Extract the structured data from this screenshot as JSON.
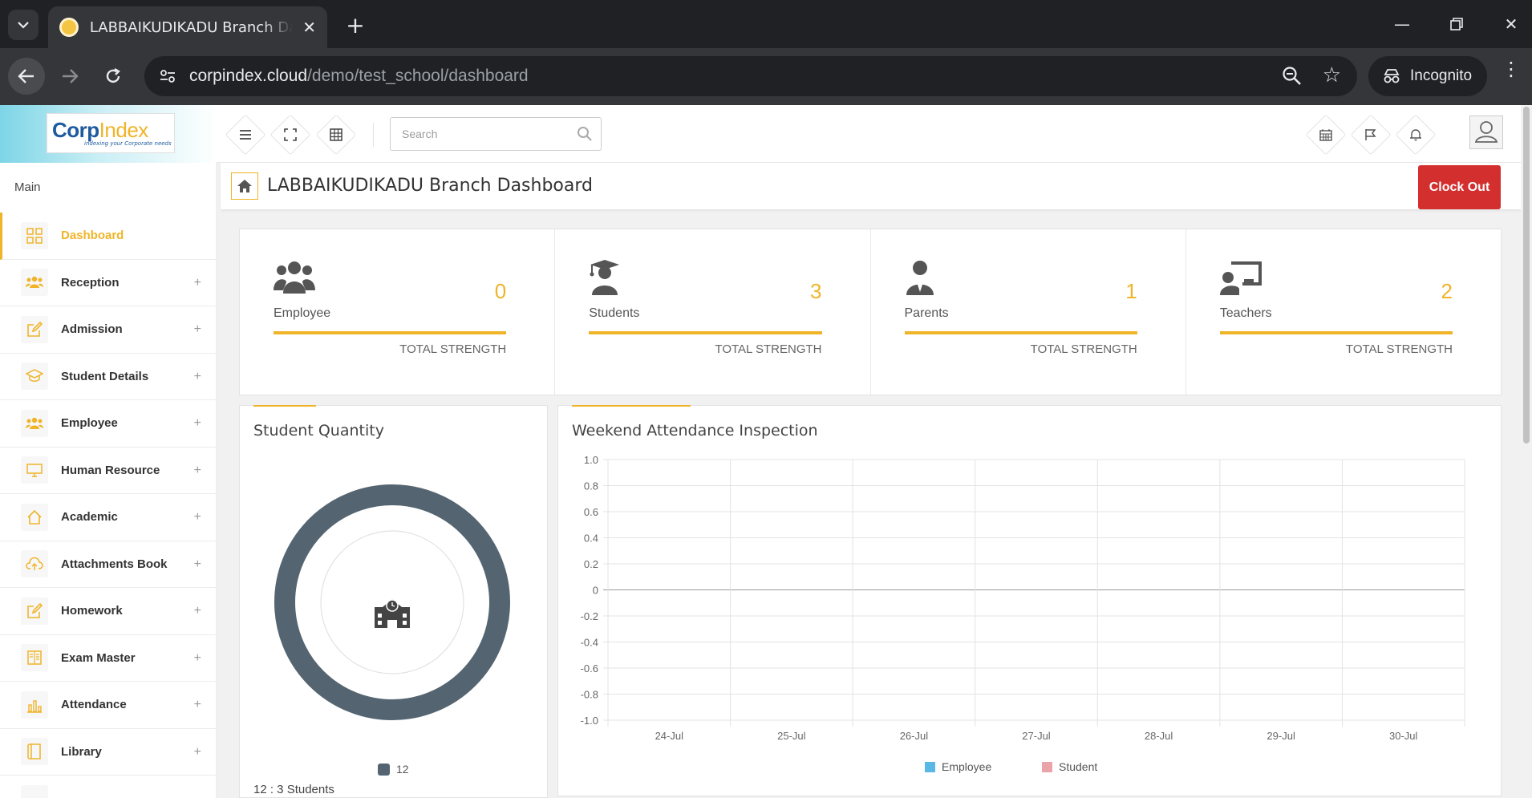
{
  "browser": {
    "tab_title": "LABBAIKUDIKADU Branch Dashboard",
    "url_host": "corpindex.cloud",
    "url_path": "/demo/test_school/dashboard",
    "profile_label": "Incognito"
  },
  "header": {
    "logo_main": "Corp",
    "logo_accent": "Index",
    "logo_tagline": "indexing your Corporate needs",
    "search_placeholder": "Search"
  },
  "sidebar": {
    "section": "Main",
    "items": [
      {
        "label": "Dashboard",
        "icon": "grid-icon",
        "active": true
      },
      {
        "label": "Reception",
        "icon": "users-icon"
      },
      {
        "label": "Admission",
        "icon": "edit-icon"
      },
      {
        "label": "Student Details",
        "icon": "graduation-cap-icon"
      },
      {
        "label": "Employee",
        "icon": "users-icon"
      },
      {
        "label": "Human Resource",
        "icon": "monitor-icon"
      },
      {
        "label": "Academic",
        "icon": "home-icon"
      },
      {
        "label": "Attachments Book",
        "icon": "cloud-upload-icon"
      },
      {
        "label": "Homework",
        "icon": "edit-icon"
      },
      {
        "label": "Exam Master",
        "icon": "book-icon"
      },
      {
        "label": "Attendance",
        "icon": "bar-chart-icon"
      },
      {
        "label": "Library",
        "icon": "book-icon"
      }
    ]
  },
  "page": {
    "title": "LABBAIKUDIKADU Branch Dashboard",
    "clock_out": "Clock Out"
  },
  "stats": [
    {
      "label": "Employee",
      "value": "0",
      "sub": "TOTAL STRENGTH",
      "icon": "employees-icon"
    },
    {
      "label": "Students",
      "value": "3",
      "sub": "TOTAL STRENGTH",
      "icon": "student-icon"
    },
    {
      "label": "Parents",
      "value": "1",
      "sub": "TOTAL STRENGTH",
      "icon": "parent-icon"
    },
    {
      "label": "Teachers",
      "value": "2",
      "sub": "TOTAL STRENGTH",
      "icon": "teacher-icon"
    }
  ],
  "student_quantity": {
    "title": "Student Quantity",
    "legend": "12",
    "footer": "12 : 3 Students"
  },
  "colors": {
    "accent": "#f0b429",
    "danger": "#d32f2f",
    "donut": "#546571",
    "employee_series": "#5bb8e6",
    "student_series": "#e9a3a9"
  },
  "chart_data": {
    "type": "line",
    "title": "Weekend Attendance Inspection",
    "categories": [
      "24-Jul",
      "25-Jul",
      "26-Jul",
      "27-Jul",
      "28-Jul",
      "29-Jul",
      "30-Jul"
    ],
    "ylim": [
      -1.0,
      1.0
    ],
    "yticks": [
      "1.0",
      "0.8",
      "0.6",
      "0.4",
      "0.2",
      "0",
      "-0.2",
      "-0.4",
      "-0.6",
      "-0.8",
      "-1.0"
    ],
    "grid": true,
    "legend_position": "bottom",
    "series": [
      {
        "name": "Employee",
        "values": []
      },
      {
        "name": "Student",
        "values": []
      }
    ]
  }
}
